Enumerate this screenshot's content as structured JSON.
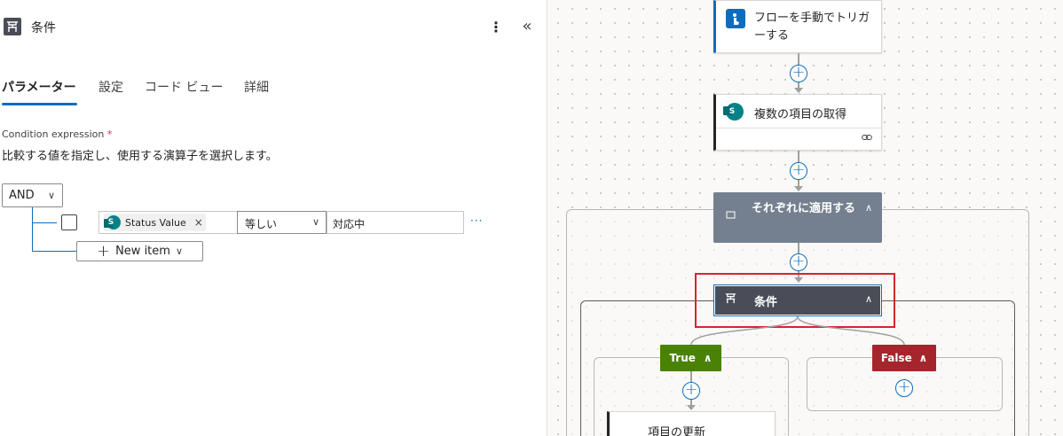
{
  "panel": {
    "title": "条件",
    "more_icon": "more-vertical-icon",
    "collapse_icon": "double-chevron-left-icon",
    "tabs": [
      {
        "label": "パラメーター",
        "active": true
      },
      {
        "label": "設定",
        "active": false
      },
      {
        "label": "コード ビュー",
        "active": false
      },
      {
        "label": "詳細",
        "active": false
      }
    ],
    "condition": {
      "label": "Condition expression",
      "required_mark": "*",
      "description": "比較する値を指定し、使用する演算子を選択します。",
      "group_operator": "AND",
      "row": {
        "token_label": "Status Value",
        "token_close": "×",
        "operator": "等しい",
        "value": "対応中",
        "more": "···"
      },
      "new_item_label": "New item"
    }
  },
  "canvas": {
    "trigger": {
      "label": "フローを手動でトリガーする"
    },
    "get_items": {
      "label": "複数の項目の取得"
    },
    "apply_to_each": {
      "label": "それぞれに適用する"
    },
    "condition": {
      "label": "条件"
    },
    "true_branch": {
      "label": "True"
    },
    "false_branch": {
      "label": "False"
    },
    "update_item": {
      "label": "項目の更新"
    },
    "colors": {
      "accent": "#0f6cbd",
      "true": "#498205",
      "false": "#a4262c",
      "condition_card": "#4a4d57",
      "apply_card": "#74808f",
      "highlight": "#d9232d"
    }
  }
}
